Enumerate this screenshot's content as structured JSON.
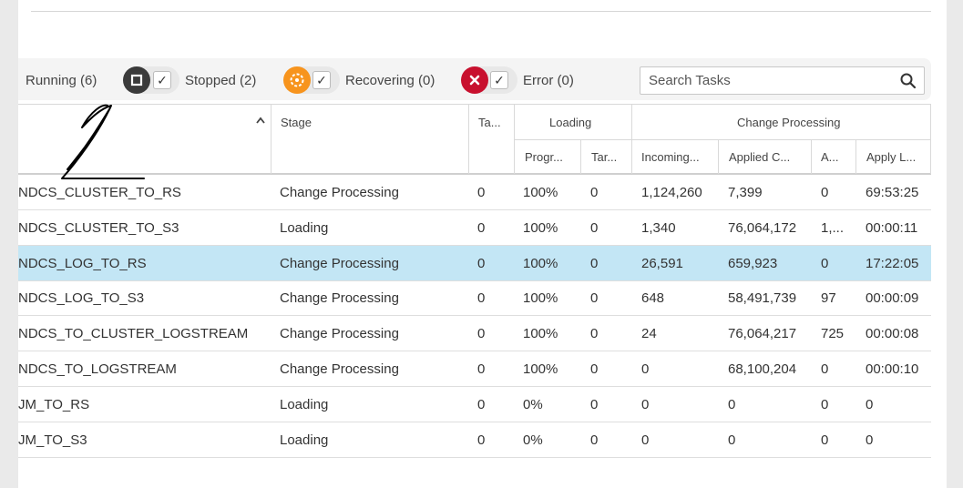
{
  "filters": {
    "running_label": "Running (6)",
    "stopped_label": "Stopped (2)",
    "recovering_label": "Recovering (0)",
    "error_label": "Error (0)",
    "checkmark": "✓",
    "colors": {
      "stopped": "#3a3a3a",
      "recovering": "#f7941d",
      "error": "#c8102e"
    }
  },
  "search": {
    "placeholder": "Search Tasks"
  },
  "table": {
    "headers": {
      "stage": "Stage",
      "tables": "Ta...",
      "loading_group": "Loading",
      "progress": "Progr...",
      "target": "Tar...",
      "change_group": "Change Processing",
      "incoming": "Incoming...",
      "applied": "Applied C...",
      "a": "A...",
      "apply_latency": "Apply L..."
    },
    "rows": [
      {
        "name": "NDCS_CLUSTER_TO_RS",
        "stage": "Change Processing",
        "tables": "0",
        "progress": "100%",
        "target": "0",
        "incoming": "1,124,260",
        "applied": "7,399",
        "a": "0",
        "latency": "69:53:25"
      },
      {
        "name": "NDCS_CLUSTER_TO_S3",
        "stage": "Loading",
        "tables": "0",
        "progress": "100%",
        "target": "0",
        "incoming": "1,340",
        "applied": "76,064,172",
        "a": "1,...",
        "latency": "00:00:11"
      },
      {
        "name": "NDCS_LOG_TO_RS",
        "stage": "Change Processing",
        "tables": "0",
        "progress": "100%",
        "target": "0",
        "incoming": "26,591",
        "applied": "659,923",
        "a": "0",
        "latency": "17:22:05"
      },
      {
        "name": "NDCS_LOG_TO_S3",
        "stage": "Change Processing",
        "tables": "0",
        "progress": "100%",
        "target": "0",
        "incoming": "648",
        "applied": "58,491,739",
        "a": "97",
        "latency": "00:00:09"
      },
      {
        "name": "NDCS_TO_CLUSTER_LOGSTREAM",
        "stage": "Change Processing",
        "tables": "0",
        "progress": "100%",
        "target": "0",
        "incoming": "24",
        "applied": "76,064,217",
        "a": "725",
        "latency": "00:00:08"
      },
      {
        "name": "NDCS_TO_LOGSTREAM",
        "stage": "Change Processing",
        "tables": "0",
        "progress": "100%",
        "target": "0",
        "incoming": "0",
        "applied": "68,100,204",
        "a": "0",
        "latency": "00:00:10"
      },
      {
        "name": "JM_TO_RS",
        "stage": "Loading",
        "tables": "0",
        "progress": "0%",
        "target": "0",
        "incoming": "0",
        "applied": "0",
        "a": "0",
        "latency": "0"
      },
      {
        "name": "JM_TO_S3",
        "stage": "Loading",
        "tables": "0",
        "progress": "0%",
        "target": "0",
        "incoming": "0",
        "applied": "0",
        "a": "0",
        "latency": "0"
      }
    ],
    "selected_row": 2
  }
}
